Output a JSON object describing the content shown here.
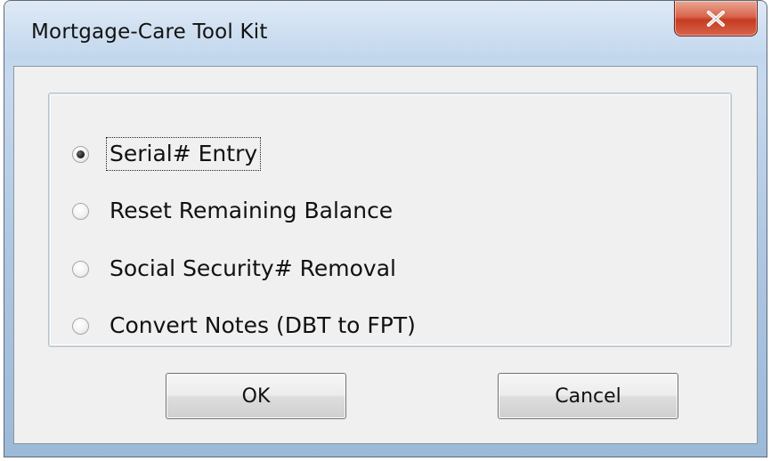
{
  "window": {
    "title": "Mortgage-Care Tool Kit",
    "close_icon": "close-x-icon"
  },
  "options": [
    {
      "label": "Serial# Entry",
      "selected": true,
      "focused": true
    },
    {
      "label": "Reset Remaining Balance",
      "selected": false,
      "focused": false
    },
    {
      "label": "Social Security# Removal",
      "selected": false,
      "focused": false
    },
    {
      "label": "Convert Notes (DBT to FPT)",
      "selected": false,
      "focused": false
    }
  ],
  "buttons": {
    "ok_label": "OK",
    "cancel_label": "Cancel"
  },
  "colors": {
    "close_button": "#c9442a",
    "dialog_face": "#f0f0f0",
    "frame": "#b9d1ea"
  }
}
